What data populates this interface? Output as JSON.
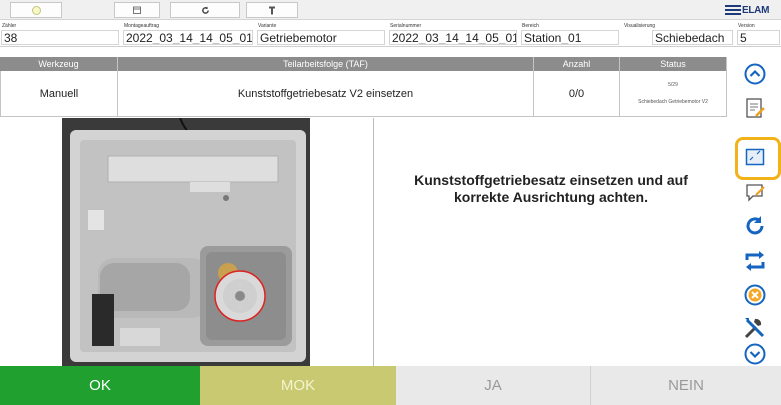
{
  "logo_text": "ELAM",
  "info": {
    "zaehler": {
      "label": "Zähler",
      "value": "38"
    },
    "montageauftrag": {
      "label": "Montageauftrag",
      "value": "2022_03_14_14_05_01"
    },
    "variante": {
      "label": "Variante",
      "value": "Getriebemotor"
    },
    "seriennummer": {
      "label": "Serialnummer",
      "value": "2022_03_14_14_05_01"
    },
    "bereich": {
      "label": "Bereich",
      "value": "Station_01"
    },
    "visualisierung": {
      "label": "Visualisierung",
      "value": "Schiebedach"
    },
    "version": {
      "label": "Version",
      "value": "5"
    }
  },
  "table": {
    "headers": {
      "werkzeug": "Werkzeug",
      "taf": "Teilarbeitsfolge (TAF)",
      "anzahl": "Anzahl",
      "status": "Status"
    },
    "row": {
      "werkzeug": "Manuell",
      "taf": "Kunststoffgetriebesatz V2 einsetzen",
      "anzahl": "0/0",
      "status_count": "5/29",
      "status_text": "Schiebedach Getriebemotor V2"
    }
  },
  "instruction": "Kunststoffgetriebesatz einsetzen und auf korrekte Ausrichtung achten.",
  "buttons": {
    "ok": "OK",
    "mok": "MOK",
    "ja": "JA",
    "nein": "NEIN"
  },
  "colors": {
    "ok": "#1fa02f",
    "mok": "#c9c972",
    "disabled": "#e9e9e9",
    "header": "#8c8c8c",
    "highlight": "#f2b31a",
    "icon_blue": "#1565c0",
    "cancel_orange": "#f5a623"
  }
}
